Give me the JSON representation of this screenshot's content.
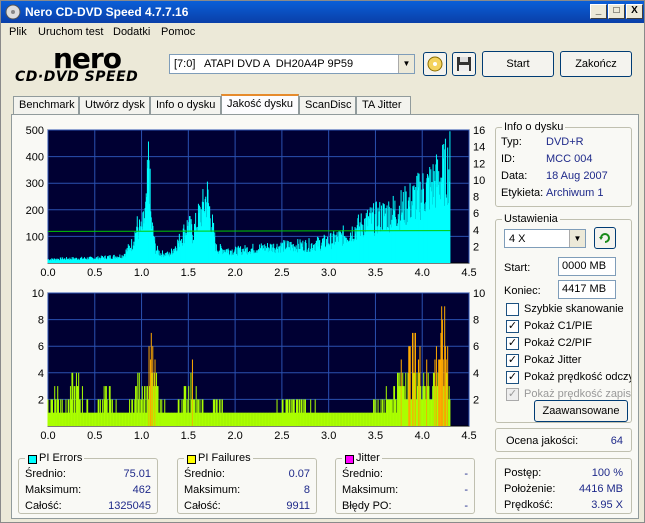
{
  "window": {
    "title": "Nero CD-DVD Speed 4.7.7.16",
    "min": "_",
    "max": "□",
    "close": "X"
  },
  "menu": [
    "Plik",
    "Uruchom test",
    "Dodatki",
    "Pomoc"
  ],
  "logo": {
    "top": "nero",
    "bottom": "CD·DVD SPEED"
  },
  "drive": {
    "selected": "[7:0]   ATAPI DVD A  DH20A4P 9P59"
  },
  "buttons": {
    "start": "Start",
    "exit": "Zakończ",
    "advanced": "Zaawansowane"
  },
  "tabs": [
    "Benchmark",
    "Utwórz dysk",
    "Info o dysku",
    "Jakość dysku",
    "ScanDisc",
    "TA Jitter"
  ],
  "active_tab": 3,
  "disc_info": {
    "title": "Info o dysku",
    "rows": [
      {
        "label": "Typ:",
        "value": "DVD+R"
      },
      {
        "label": "ID:",
        "value": "MCC 004"
      },
      {
        "label": "Data:",
        "value": "18 Aug 2007"
      },
      {
        "label": "Etykieta:",
        "value": "Archiwum 1"
      }
    ]
  },
  "settings": {
    "title": "Ustawienia",
    "speed": "4 X",
    "start_label": "Start:",
    "start_value": "0000 MB",
    "end_label": "Koniec:",
    "end_value": "4417 MB",
    "options": [
      {
        "label": "Szybkie skanowanie",
        "checked": false,
        "enabled": true
      },
      {
        "label": "Pokaż C1/PIE",
        "checked": true,
        "enabled": true
      },
      {
        "label": "Pokaż C2/PIF",
        "checked": true,
        "enabled": true
      },
      {
        "label": "Pokaż Jitter",
        "checked": true,
        "enabled": true
      },
      {
        "label": "Pokaż prędkość odczytu",
        "checked": true,
        "enabled": true
      },
      {
        "label": "Pokaż prędkość zapisu",
        "checked": true,
        "enabled": false
      }
    ]
  },
  "quality": {
    "label": "Ocena jakości:",
    "value": "64"
  },
  "pi_errors": {
    "title": "PI Errors",
    "color": "#00ffff",
    "rows": [
      {
        "label": "Średnio:",
        "value": "75.01"
      },
      {
        "label": "Maksimum:",
        "value": "462"
      },
      {
        "label": "Całość:",
        "value": "1325045"
      }
    ]
  },
  "pi_failures": {
    "title": "PI Failures",
    "color": "#ffff00",
    "rows": [
      {
        "label": "Średnio:",
        "value": "0.07"
      },
      {
        "label": "Maksimum:",
        "value": "8"
      },
      {
        "label": "Całość:",
        "value": "9911"
      }
    ]
  },
  "jitter": {
    "title": "Jitter",
    "color": "#ff00ff",
    "rows": [
      {
        "label": "Średnio:",
        "value": "-"
      },
      {
        "label": "Maksimum:",
        "value": "-"
      },
      {
        "label": "Błędy PO:",
        "value": "-"
      }
    ]
  },
  "progress": {
    "rows": [
      {
        "label": "Postęp:",
        "value": "100 %"
      },
      {
        "label": "Położenie:",
        "value": "4416 MB"
      },
      {
        "label": "Prędkość:",
        "value": "3.95 X"
      }
    ]
  },
  "colors": {
    "plot_bg": "#000033",
    "grid": "#2a50b0",
    "pie": "#00ffff",
    "pif": "#aaff00",
    "pif_peak": "#ffaa00",
    "speed": "#00cc00"
  },
  "chart_data": [
    {
      "type": "area",
      "x_ticks": [
        "0.0",
        "0.5",
        "1.0",
        "1.5",
        "2.0",
        "2.5",
        "3.0",
        "3.5",
        "4.0",
        "4.5"
      ],
      "y_left_ticks": [
        "100",
        "200",
        "300",
        "400",
        "500"
      ],
      "y_right_ticks": [
        "2",
        "4",
        "6",
        "8",
        "10",
        "12",
        "14",
        "16"
      ],
      "xlim": [
        0,
        4.5
      ],
      "ylim": [
        0,
        500
      ],
      "y2lim": [
        0,
        16
      ],
      "series": [
        {
          "values_x": [
            0,
            0.2,
            0.5,
            0.8,
            0.9,
            0.95,
            1.0,
            1.05,
            1.08,
            1.1,
            1.15,
            1.2,
            1.3,
            1.4,
            1.5,
            1.55,
            1.6,
            1.65,
            1.7,
            1.75,
            1.8,
            1.9,
            2.0,
            2.2,
            2.5,
            2.8,
            3.0,
            3.2,
            3.4,
            3.6,
            3.8,
            3.9,
            4.0,
            4.1,
            4.2,
            4.25,
            4.3
          ],
          "values_y": [
            15,
            18,
            20,
            30,
            80,
            150,
            130,
            220,
            450,
            180,
            60,
            40,
            35,
            90,
            160,
            120,
            180,
            220,
            280,
            170,
            60,
            55,
            50,
            60,
            70,
            75,
            90,
            120,
            170,
            200,
            230,
            260,
            290,
            320,
            360,
            380,
            410
          ]
        },
        {
          "values_x": [
            0,
            4.3
          ],
          "values_y": [
            3.8,
            3.9
          ]
        }
      ]
    },
    {
      "type": "bar",
      "x_ticks": [
        "0.0",
        "0.5",
        "1.0",
        "1.5",
        "2.0",
        "2.5",
        "3.0",
        "3.5",
        "4.0",
        "4.5"
      ],
      "y_left_ticks": [
        "2",
        "4",
        "6",
        "8",
        "10"
      ],
      "y_right_ticks": [
        "2",
        "4",
        "6",
        "8",
        "10"
      ],
      "xlim": [
        0,
        4.5
      ],
      "ylim": [
        0,
        10
      ],
      "series": [
        {
          "values_x": [
            0.0,
            0.1,
            0.2,
            0.3,
            0.4,
            0.5,
            0.6,
            0.7,
            0.8,
            0.9,
            1.0,
            1.05,
            1.1,
            1.2,
            1.3,
            1.4,
            1.5,
            1.55,
            1.6,
            1.7,
            1.8,
            1.9,
            2.0,
            2.3,
            2.6,
            3.0,
            3.4,
            3.7,
            3.8,
            3.9,
            4.0,
            4.1,
            4.15,
            4.2,
            4.25,
            4.3
          ],
          "values_y": [
            2,
            3,
            2,
            4,
            2,
            1,
            3,
            2,
            1,
            2,
            4,
            3,
            6,
            2,
            1,
            2,
            3,
            5,
            2,
            1,
            2,
            1,
            1,
            1,
            2,
            1,
            1,
            3,
            5,
            6,
            5,
            4,
            6,
            7,
            8,
            5
          ]
        }
      ]
    }
  ]
}
